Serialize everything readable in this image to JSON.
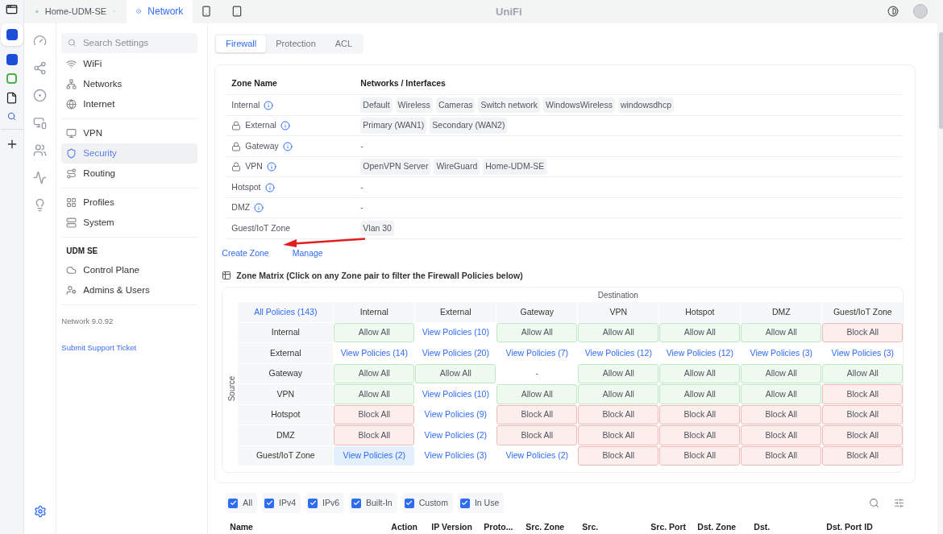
{
  "top_bar": {
    "site": "Home-UDM-SE",
    "tabs": [
      {
        "label": "Network",
        "selected": true
      }
    ],
    "logo": "UniFi"
  },
  "settings_nav": {
    "search": {
      "placeholder": "Search Settings"
    },
    "groups": [
      {
        "items": [
          {
            "label": "WiFi",
            "selected": false
          },
          {
            "label": "Networks",
            "selected": false
          },
          {
            "label": "Internet",
            "selected": false
          }
        ]
      },
      {
        "items": [
          {
            "label": "VPN",
            "selected": false
          },
          {
            "label": "Security",
            "selected": true
          },
          {
            "label": "Routing",
            "selected": false
          }
        ]
      },
      {
        "items": [
          {
            "label": "Profiles",
            "selected": false
          },
          {
            "label": "System",
            "selected": false
          }
        ]
      },
      {
        "heading": "UDM SE",
        "items": [
          {
            "label": "Control Plane",
            "selected": false
          },
          {
            "label": "Admins & Users",
            "selected": false
          }
        ]
      }
    ],
    "version": "Network 9.0.92",
    "support_link": "Submit Support Ticket"
  },
  "tabs": [
    {
      "label": "Firewall",
      "selected": true
    },
    {
      "label": "Protection",
      "selected": false
    },
    {
      "label": "ACL",
      "selected": false
    }
  ],
  "zones": {
    "columns": [
      "Zone Name",
      "Networks / Interfaces"
    ],
    "rows": [
      {
        "name": "Internal",
        "locked": false,
        "info": true,
        "networks": [
          "Default",
          "Wireless",
          "Cameras",
          "Switch network",
          "WindowsWireless",
          "windowsdhcp"
        ]
      },
      {
        "name": "External",
        "locked": true,
        "info": true,
        "networks": [
          "Primary (WAN1)",
          "Secondary (WAN2)"
        ]
      },
      {
        "name": "Gateway",
        "locked": true,
        "info": true,
        "value": "-"
      },
      {
        "name": "VPN",
        "locked": true,
        "info": true,
        "networks": [
          "OpenVPN Server",
          "WireGuard",
          "Home-UDM-SE"
        ]
      },
      {
        "name": "Hotspot",
        "locked": false,
        "info": true,
        "value": "-"
      },
      {
        "name": "DMZ",
        "locked": false,
        "info": true,
        "value": "-"
      },
      {
        "name": "Guest/IoT Zone",
        "locked": false,
        "info": false,
        "networks": [
          "Vlan 30"
        ]
      }
    ]
  },
  "zone_links": [
    "Create Zone",
    "Manage"
  ],
  "matrix": {
    "title": "Zone Matrix (Click on any Zone pair to filter the Firewall Policies below)",
    "destination_label": "Destination",
    "source_label": "Source",
    "all_link": "All Policies (143)",
    "columns": [
      "Internal",
      "External",
      "Gateway",
      "VPN",
      "Hotspot",
      "DMZ",
      "Guest/IoT Zone"
    ],
    "rows": [
      {
        "name": "Internal",
        "cells": [
          {
            "kind": "allow",
            "text": "Allow All",
            "selected": false
          },
          {
            "kind": "view",
            "text": "View Policies (10)",
            "selected": false
          },
          {
            "kind": "allow",
            "text": "Allow All",
            "selected": false
          },
          {
            "kind": "allow",
            "text": "Allow All",
            "selected": false
          },
          {
            "kind": "allow",
            "text": "Allow All",
            "selected": false
          },
          {
            "kind": "allow",
            "text": "Allow All",
            "selected": false
          },
          {
            "kind": "block",
            "text": "Block All",
            "selected": false
          }
        ]
      },
      {
        "name": "External",
        "cells": [
          {
            "kind": "view",
            "text": "View Policies (14)",
            "selected": false
          },
          {
            "kind": "view",
            "text": "View Policies (20)",
            "selected": false
          },
          {
            "kind": "view",
            "text": "View Policies (7)",
            "selected": false
          },
          {
            "kind": "view",
            "text": "View Policies (12)",
            "selected": false
          },
          {
            "kind": "view",
            "text": "View Policies (12)",
            "selected": false
          },
          {
            "kind": "view",
            "text": "View Policies (3)",
            "selected": false
          },
          {
            "kind": "view",
            "text": "View Policies (3)",
            "selected": false
          }
        ]
      },
      {
        "name": "Gateway",
        "cells": [
          {
            "kind": "allow",
            "text": "Allow All",
            "selected": false
          },
          {
            "kind": "allow",
            "text": "Allow All",
            "selected": false
          },
          {
            "kind": "none",
            "text": "-",
            "selected": false
          },
          {
            "kind": "allow",
            "text": "Allow All",
            "selected": false
          },
          {
            "kind": "allow",
            "text": "Allow All",
            "selected": false
          },
          {
            "kind": "allow",
            "text": "Allow All",
            "selected": false
          },
          {
            "kind": "allow",
            "text": "Allow All",
            "selected": false
          }
        ]
      },
      {
        "name": "VPN",
        "cells": [
          {
            "kind": "allow",
            "text": "Allow All",
            "selected": false
          },
          {
            "kind": "view",
            "text": "View Policies (10)",
            "selected": false
          },
          {
            "kind": "allow",
            "text": "Allow All",
            "selected": false
          },
          {
            "kind": "allow",
            "text": "Allow All",
            "selected": false
          },
          {
            "kind": "allow",
            "text": "Allow All",
            "selected": false
          },
          {
            "kind": "allow",
            "text": "Allow All",
            "selected": false
          },
          {
            "kind": "block",
            "text": "Block All",
            "selected": false
          }
        ]
      },
      {
        "name": "Hotspot",
        "cells": [
          {
            "kind": "block",
            "text": "Block All",
            "selected": false
          },
          {
            "kind": "view",
            "text": "View Policies (9)",
            "selected": false
          },
          {
            "kind": "block",
            "text": "Block All",
            "selected": false
          },
          {
            "kind": "block",
            "text": "Block All",
            "selected": false
          },
          {
            "kind": "block",
            "text": "Block All",
            "selected": false
          },
          {
            "kind": "block",
            "text": "Block All",
            "selected": false
          },
          {
            "kind": "block",
            "text": "Block All",
            "selected": false
          }
        ]
      },
      {
        "name": "DMZ",
        "cells": [
          {
            "kind": "block",
            "text": "Block All",
            "selected": false
          },
          {
            "kind": "view",
            "text": "View Policies (2)",
            "selected": false
          },
          {
            "kind": "block",
            "text": "Block All",
            "selected": false
          },
          {
            "kind": "block",
            "text": "Block All",
            "selected": false
          },
          {
            "kind": "block",
            "text": "Block All",
            "selected": false
          },
          {
            "kind": "block",
            "text": "Block All",
            "selected": false
          },
          {
            "kind": "block",
            "text": "Block All",
            "selected": false
          }
        ]
      },
      {
        "name": "Guest/IoT Zone",
        "cells": [
          {
            "kind": "view",
            "text": "View Policies (2)",
            "selected": true
          },
          {
            "kind": "view",
            "text": "View Policies (3)",
            "selected": false
          },
          {
            "kind": "view",
            "text": "View Policies (2)",
            "selected": false
          },
          {
            "kind": "block",
            "text": "Block All",
            "selected": false
          },
          {
            "kind": "block",
            "text": "Block All",
            "selected": false
          },
          {
            "kind": "block",
            "text": "Block All",
            "selected": false
          },
          {
            "kind": "block",
            "text": "Block All",
            "selected": false
          }
        ]
      }
    ]
  },
  "filters": [
    {
      "label": "All",
      "checked": true
    },
    {
      "label": "IPv4",
      "checked": true
    },
    {
      "label": "IPv6",
      "checked": true
    },
    {
      "label": "Built-In",
      "checked": true
    },
    {
      "label": "Custom",
      "checked": true
    },
    {
      "label": "In Use",
      "checked": true
    }
  ],
  "policy_columns": [
    "Name",
    "Action",
    "IP Version",
    "Proto...",
    "Src. Zone",
    "Src.",
    "Src. Port",
    "Dst. Zone",
    "Dst.",
    "Dst. Port",
    "ID"
  ]
}
